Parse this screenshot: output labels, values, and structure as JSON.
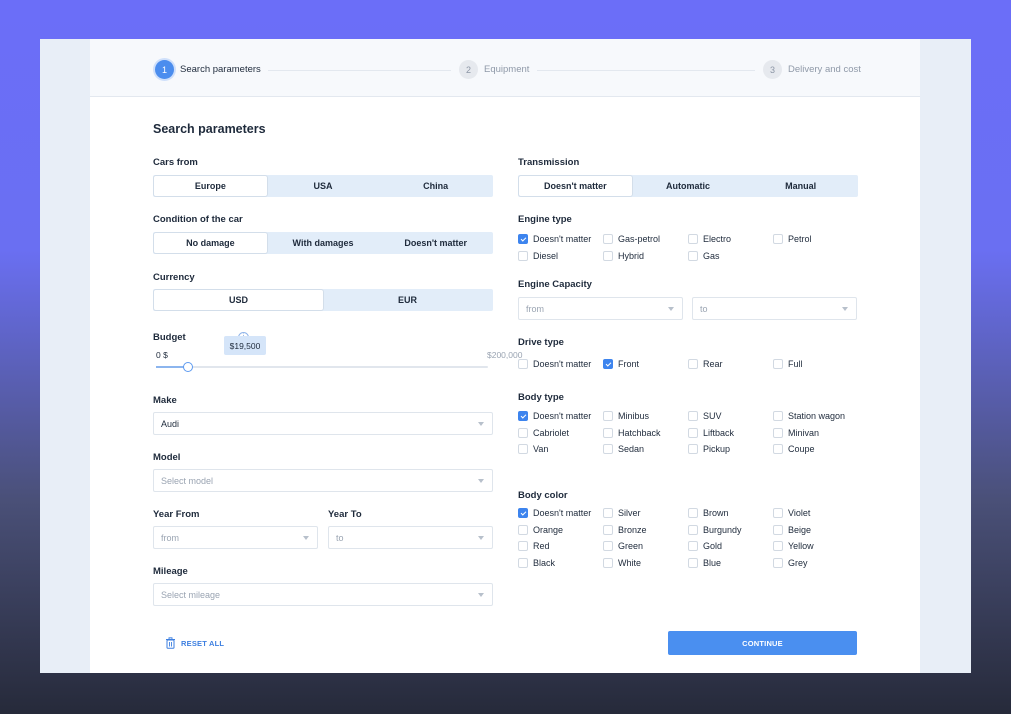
{
  "steps": [
    {
      "num": "1",
      "label": "Search parameters"
    },
    {
      "num": "2",
      "label": "Equipment"
    },
    {
      "num": "3",
      "label": "Delivery and cost"
    }
  ],
  "title": "Search parameters",
  "cars_from": {
    "label": "Cars from",
    "options": [
      "Europe",
      "USA",
      "China"
    ],
    "selected": "Europe"
  },
  "condition": {
    "label": "Condition of the car",
    "options": [
      "No damage",
      "With damages",
      "Doesn't matter"
    ],
    "selected": "No damage"
  },
  "currency": {
    "label": "Currency",
    "options": [
      "USD",
      "EUR"
    ],
    "selected": "USD"
  },
  "budget": {
    "label": "Budget",
    "min_label": "0 $",
    "max_label": "$200,000",
    "value_label": "$19,500",
    "value": 19500,
    "max": 200000
  },
  "make": {
    "label": "Make",
    "value": "Audi"
  },
  "model": {
    "label": "Model",
    "placeholder": "Select model"
  },
  "year_from": {
    "label": "Year From",
    "placeholder": "from"
  },
  "year_to": {
    "label": "Year To",
    "placeholder": "to"
  },
  "mileage": {
    "label": "Mileage",
    "placeholder": "Select mileage"
  },
  "transmission": {
    "label": "Transmission",
    "options": [
      "Doesn't matter",
      "Automatic",
      "Manual"
    ],
    "selected": "Doesn't matter"
  },
  "engine_type": {
    "label": "Engine type",
    "options": [
      {
        "label": "Doesn't matter",
        "checked": true
      },
      {
        "label": "Gas-petrol",
        "checked": false
      },
      {
        "label": "Electro",
        "checked": false
      },
      {
        "label": "Petrol",
        "checked": false
      },
      {
        "label": "Diesel",
        "checked": false
      },
      {
        "label": "Hybrid",
        "checked": false
      },
      {
        "label": "Gas",
        "checked": false
      }
    ]
  },
  "engine_capacity": {
    "label": "Engine Capacity",
    "from_placeholder": "from",
    "to_placeholder": "to"
  },
  "drive_type": {
    "label": "Drive type",
    "options": [
      {
        "label": "Doesn't matter",
        "checked": false
      },
      {
        "label": "Front",
        "checked": true
      },
      {
        "label": "Rear",
        "checked": false
      },
      {
        "label": "Full",
        "checked": false
      }
    ]
  },
  "body_type": {
    "label": "Body type",
    "options": [
      {
        "label": "Doesn't matter",
        "checked": true
      },
      {
        "label": "Minibus",
        "checked": false
      },
      {
        "label": "SUV",
        "checked": false
      },
      {
        "label": "Station wagon",
        "checked": false
      },
      {
        "label": "Cabriolet",
        "checked": false
      },
      {
        "label": "Hatchback",
        "checked": false
      },
      {
        "label": "Liftback",
        "checked": false
      },
      {
        "label": "Minivan",
        "checked": false
      },
      {
        "label": "Van",
        "checked": false
      },
      {
        "label": "Sedan",
        "checked": false
      },
      {
        "label": "Pickup",
        "checked": false
      },
      {
        "label": "Coupe",
        "checked": false
      }
    ]
  },
  "body_color": {
    "label": "Body color",
    "options": [
      {
        "label": "Doesn't matter",
        "checked": true
      },
      {
        "label": "Silver",
        "checked": false
      },
      {
        "label": "Brown",
        "checked": false
      },
      {
        "label": "Violet",
        "checked": false
      },
      {
        "label": "Orange",
        "checked": false
      },
      {
        "label": "Bronze",
        "checked": false
      },
      {
        "label": "Burgundy",
        "checked": false
      },
      {
        "label": "Beige",
        "checked": false
      },
      {
        "label": "Red",
        "checked": false
      },
      {
        "label": "Green",
        "checked": false
      },
      {
        "label": "Gold",
        "checked": false
      },
      {
        "label": "Yellow",
        "checked": false
      },
      {
        "label": "Black",
        "checked": false
      },
      {
        "label": "White",
        "checked": false
      },
      {
        "label": "Blue",
        "checked": false
      },
      {
        "label": "Grey",
        "checked": false
      }
    ]
  },
  "actions": {
    "reset_label": "RESET ALL",
    "continue_label": "CONTINUE"
  },
  "colors": {
    "accent": "#4a8ff0",
    "segment_bg": "#e2edf9",
    "text": "#1e2a3b",
    "muted": "#9aa4b2"
  }
}
